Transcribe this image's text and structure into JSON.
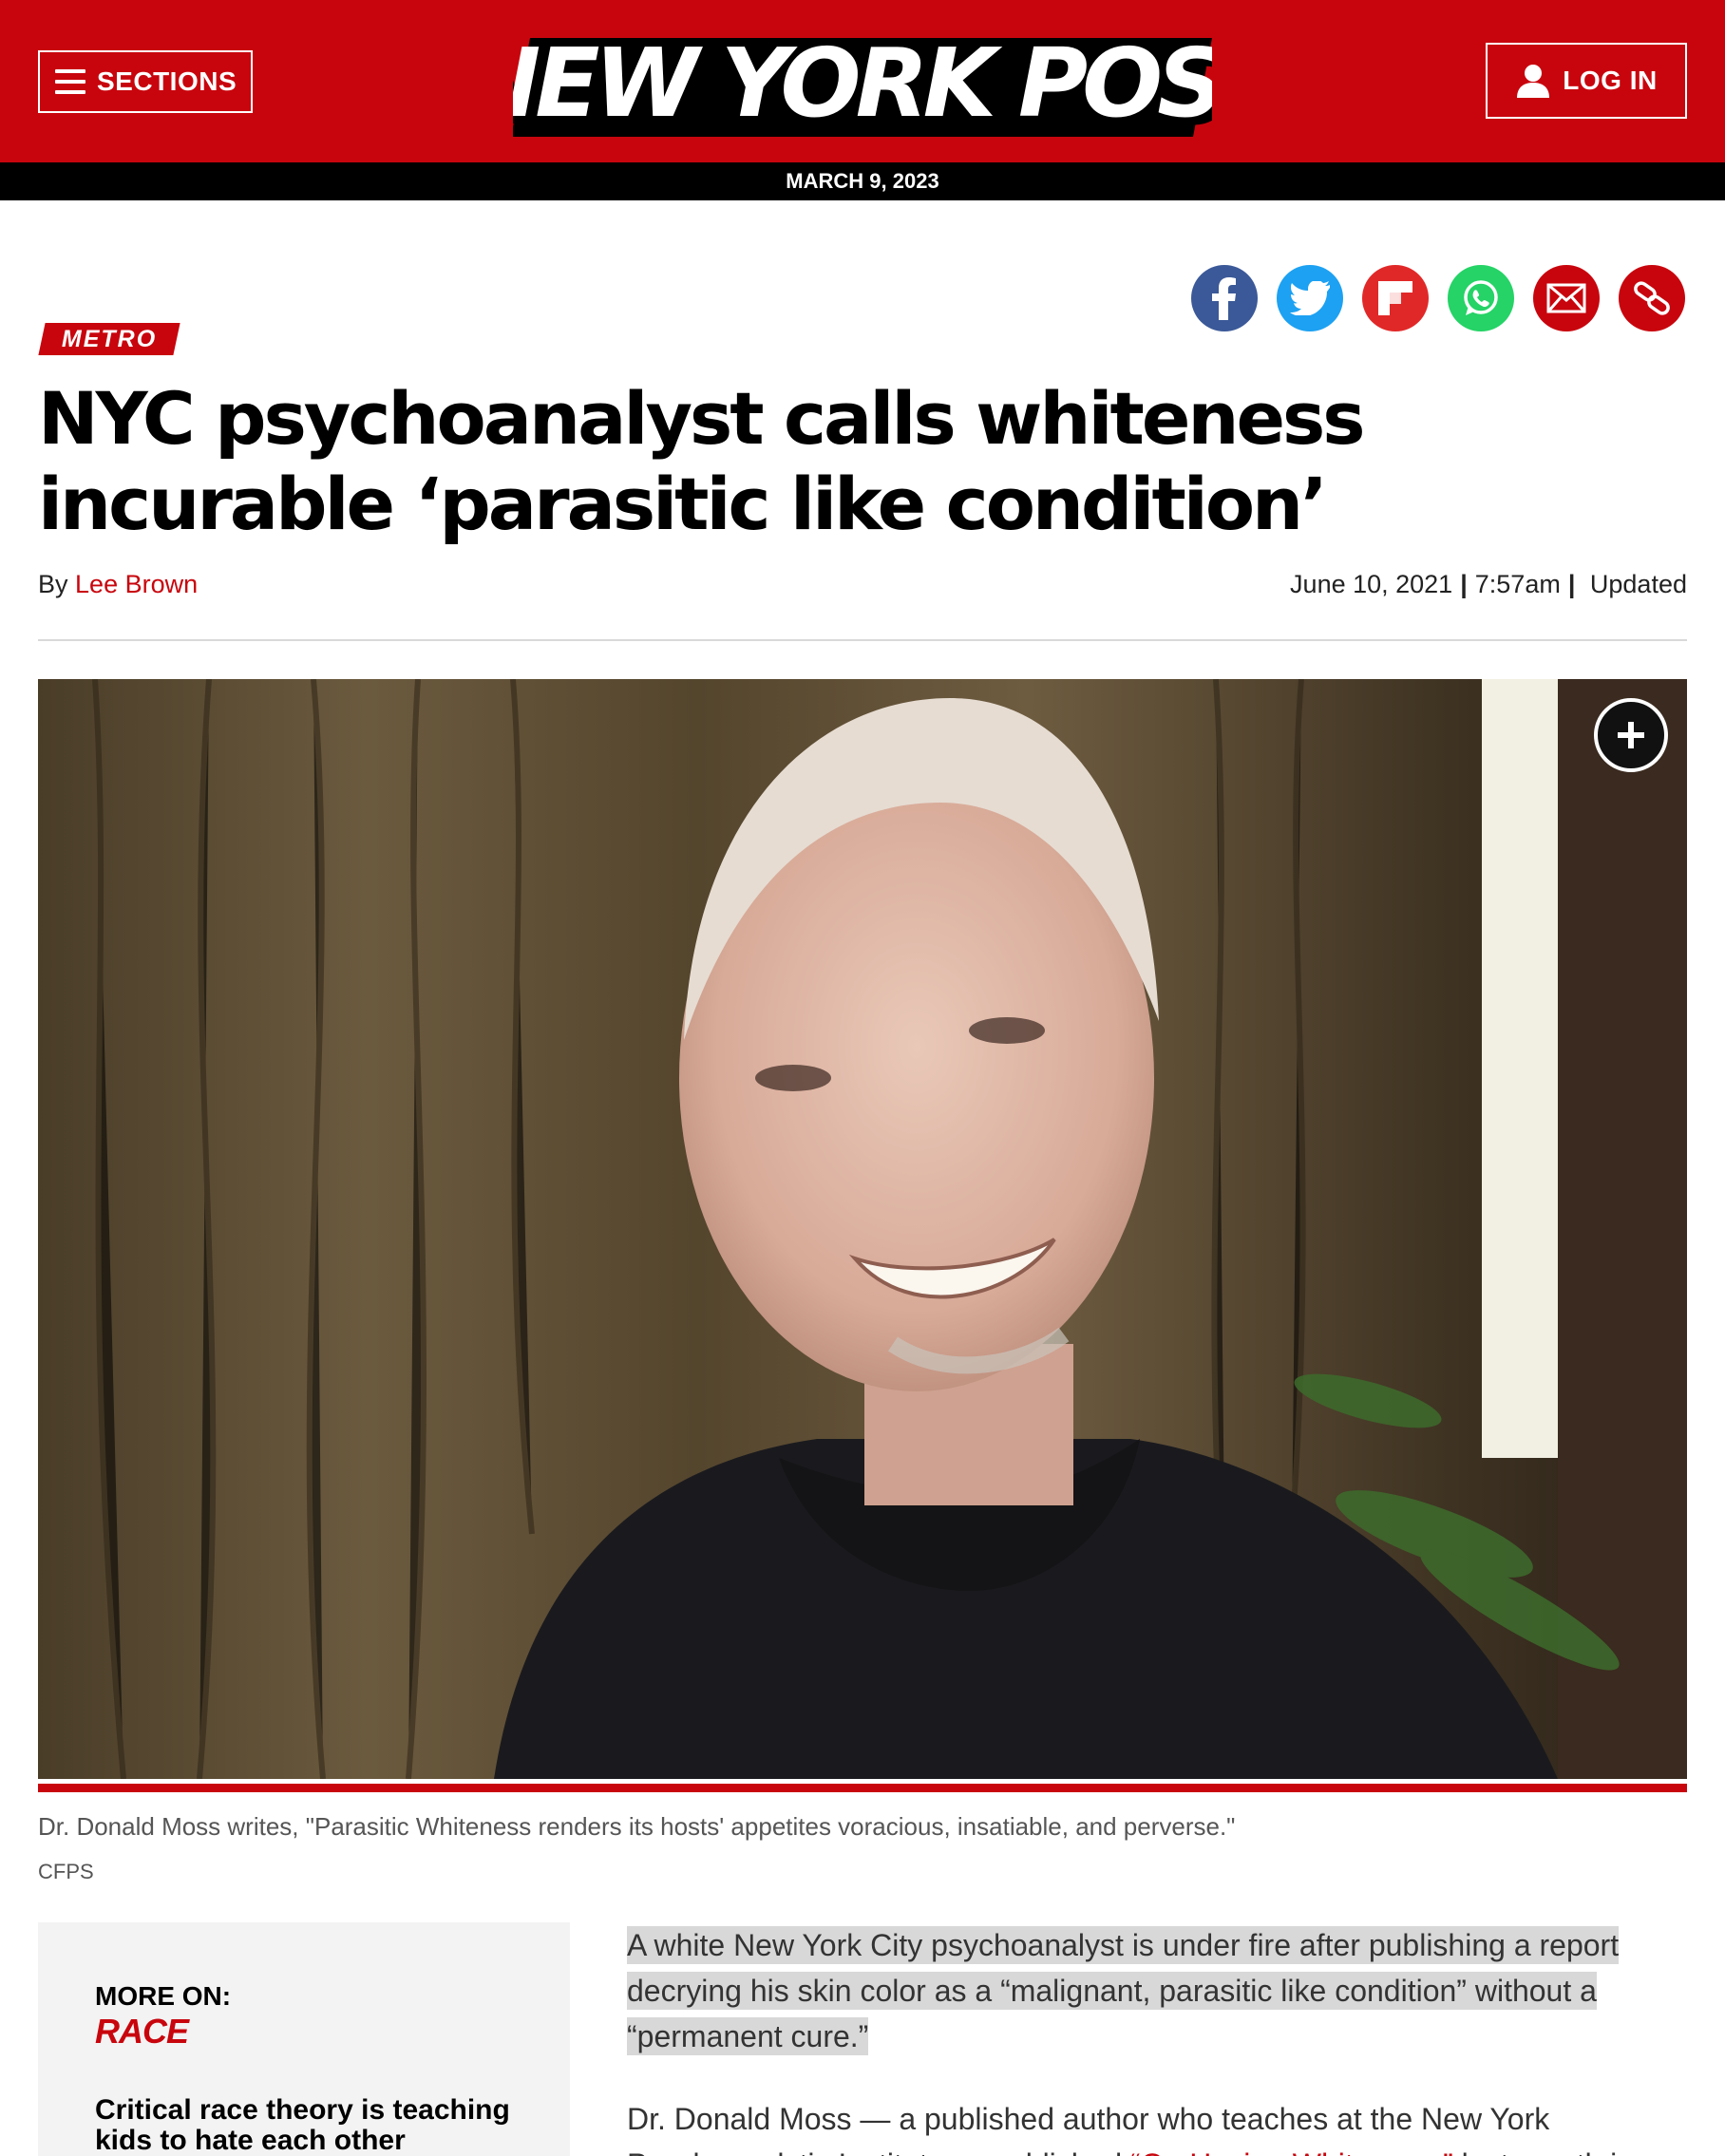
{
  "header": {
    "sections_label": "SECTIONS",
    "logo_text": "NEW YORK POST",
    "login_label": "LOG IN",
    "date": "MARCH 9, 2023",
    "brand_color": "#c8050d"
  },
  "share": {
    "icons": [
      "facebook-icon",
      "twitter-icon",
      "flipboard-icon",
      "whatsapp-icon",
      "email-icon",
      "copy-link-icon"
    ]
  },
  "article": {
    "category": "METRO",
    "headline": "NYC psychoanalyst calls whiteness incurable ‘parasitic like condition’",
    "byline_prefix": "By",
    "author": "Lee Brown",
    "date": "June 10, 2021",
    "time": "7:57am",
    "updated_label": "Updated",
    "caption": "Dr. Donald Moss writes, \"Parasitic Whiteness renders its hosts' appetites voracious, insatiable, and perverse.\"",
    "credit": "CFPS",
    "lead": "A white New York City psychoanalyst is under fire after publishing a report decrying his skin color as a “malignant, parasitic like condition” without a “permanent cure.”",
    "para2_start": "Dr. Donald Moss — a published author who teaches at the New York",
    "para2_rest": "Psychoanalytic Institute — published ",
    "para2_link": "“On Having Whiteness,”",
    "para2_end": " last month in the"
  },
  "sidebar": {
    "label": "MORE ON:",
    "topic": "RACE",
    "link": "Critical race theory is teaching kids to hate each other"
  }
}
